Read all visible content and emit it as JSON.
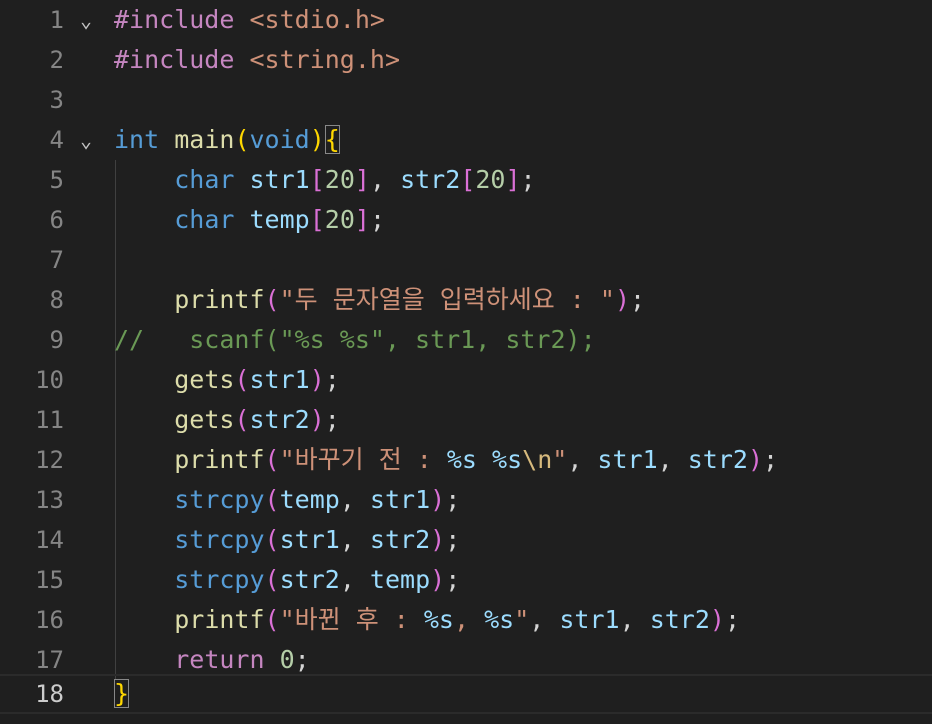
{
  "line_numbers": [
    "1",
    "2",
    "3",
    "4",
    "5",
    "6",
    "7",
    "8",
    "9",
    "10",
    "11",
    "12",
    "13",
    "14",
    "15",
    "16",
    "17",
    "18"
  ],
  "fold_icon": "chevron-down-icon",
  "tokens": {
    "l1_directive": "#include",
    "l1_header": "<stdio.h>",
    "l2_directive": "#include",
    "l2_header": "<string.h>",
    "l4_type": "int",
    "l4_func": "main",
    "l4_lparen": "(",
    "l4_param": "void",
    "l4_rparen": ")",
    "l4_brace": "{",
    "l5_type": "char",
    "l5_var1": "str1",
    "l5_lb1": "[",
    "l5_num1": "20",
    "l5_rb1": "]",
    "l5_comma": ",",
    "l5_var2": "str2",
    "l5_lb2": "[",
    "l5_num2": "20",
    "l5_rb2": "]",
    "l5_semi": ";",
    "l6_type": "char",
    "l6_var": "temp",
    "l6_lb": "[",
    "l6_num": "20",
    "l6_rb": "]",
    "l6_semi": ";",
    "l8_func": "printf",
    "l8_lp": "(",
    "l8_str": "\"두 문자열을 입력하세요 : \"",
    "l8_rp": ")",
    "l8_semi": ";",
    "l9_comment": "//   scanf(\"%s %s\", str1, str2);",
    "l10_func": "gets",
    "l10_lp": "(",
    "l10_arg": "str1",
    "l10_rp": ")",
    "l10_semi": ";",
    "l11_func": "gets",
    "l11_lp": "(",
    "l11_arg": "str2",
    "l11_rp": ")",
    "l11_semi": ";",
    "l12_func": "printf",
    "l12_lp": "(",
    "l12_str_a": "\"바꾸기 전 : ",
    "l12_fmt1": "%s",
    "l12_space": " ",
    "l12_fmt2": "%s",
    "l12_esc": "\\n",
    "l12_str_b": "\"",
    "l12_c1": ", ",
    "l12_arg1": "str1",
    "l12_c2": ", ",
    "l12_arg2": "str2",
    "l12_rp": ")",
    "l12_semi": ";",
    "l13_func": "strcpy",
    "l13_lp": "(",
    "l13_arg1": "temp",
    "l13_c": ", ",
    "l13_arg2": "str1",
    "l13_rp": ")",
    "l13_semi": ";",
    "l14_func": "strcpy",
    "l14_lp": "(",
    "l14_arg1": "str1",
    "l14_c": ", ",
    "l14_arg2": "str2",
    "l14_rp": ")",
    "l14_semi": ";",
    "l15_func": "strcpy",
    "l15_lp": "(",
    "l15_arg1": "str2",
    "l15_c": ", ",
    "l15_arg2": "temp",
    "l15_rp": ")",
    "l15_semi": ";",
    "l16_func": "printf",
    "l16_lp": "(",
    "l16_str_a": "\"바뀐 후 : ",
    "l16_fmt1": "%s",
    "l16_str_b": ", ",
    "l16_fmt2": "%s",
    "l16_str_c": "\"",
    "l16_c1": ", ",
    "l16_arg1": "str1",
    "l16_c2": ", ",
    "l16_arg2": "str2",
    "l16_rp": ")",
    "l16_semi": ";",
    "l17_kw": "return",
    "l17_sp": " ",
    "l17_num": "0",
    "l17_semi": ";",
    "l18_brace": "}"
  },
  "colors": {
    "background": "#1f1f1f",
    "line_number": "#858585",
    "active_line_number": "#cccccc",
    "keyword": "#569cd6",
    "function": "#dcdcaa",
    "variable": "#9cdcfe",
    "number": "#b5cea8",
    "string": "#ce9178",
    "comment": "#6a9955",
    "preprocessor": "#c586c0",
    "bracket_level1": "#ffd700",
    "bracket_level2": "#da70d6",
    "bracket_level3": "#179fff"
  }
}
